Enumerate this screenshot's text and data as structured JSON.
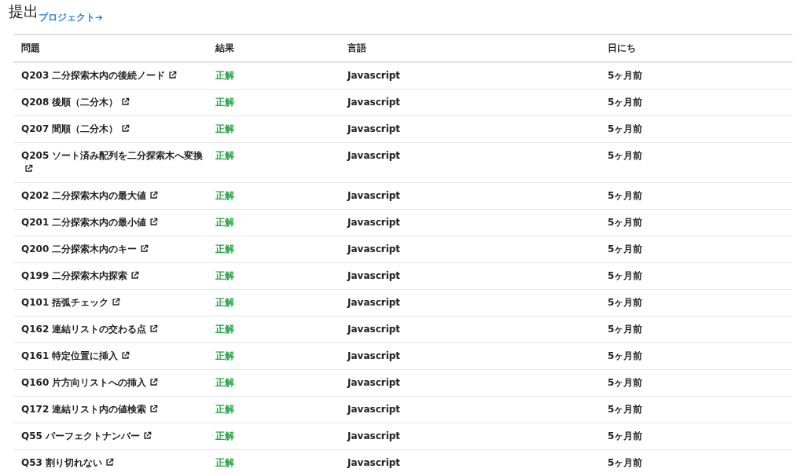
{
  "heading": {
    "title": "提出",
    "link": "プロジェクト➔"
  },
  "table": {
    "columns": [
      "問題",
      "結果",
      "言語",
      "日にち"
    ],
    "rows": [
      {
        "problem": "Q203 二分探索木内の後続ノード",
        "result": "正解",
        "language": "Javascript",
        "date": "5ヶ月前"
      },
      {
        "problem": "Q208 後順（二分木）",
        "result": "正解",
        "language": "Javascript",
        "date": "5ヶ月前"
      },
      {
        "problem": "Q207 間順（二分木）",
        "result": "正解",
        "language": "Javascript",
        "date": "5ヶ月前"
      },
      {
        "problem": "Q205 ソート済み配列を二分探索木へ変換",
        "result": "正解",
        "language": "Javascript",
        "date": "5ヶ月前"
      },
      {
        "problem": "Q202 二分探索木内の最大値",
        "result": "正解",
        "language": "Javascript",
        "date": "5ヶ月前"
      },
      {
        "problem": "Q201 二分探索木内の最小値",
        "result": "正解",
        "language": "Javascript",
        "date": "5ヶ月前"
      },
      {
        "problem": "Q200 二分探索木内のキー",
        "result": "正解",
        "language": "Javascript",
        "date": "5ヶ月前"
      },
      {
        "problem": "Q199 二分探索木内探索",
        "result": "正解",
        "language": "Javascript",
        "date": "5ヶ月前"
      },
      {
        "problem": "Q101 括弧チェック",
        "result": "正解",
        "language": "Javascript",
        "date": "5ヶ月前"
      },
      {
        "problem": "Q162 連結リストの交わる点",
        "result": "正解",
        "language": "Javascript",
        "date": "5ヶ月前"
      },
      {
        "problem": "Q161 特定位置に挿入",
        "result": "正解",
        "language": "Javascript",
        "date": "5ヶ月前"
      },
      {
        "problem": "Q160 片方向リストへの挿入",
        "result": "正解",
        "language": "Javascript",
        "date": "5ヶ月前"
      },
      {
        "problem": "Q172 連結リスト内の値検索",
        "result": "正解",
        "language": "Javascript",
        "date": "5ヶ月前"
      },
      {
        "problem": "Q55 パーフェクトナンバー",
        "result": "正解",
        "language": "Javascript",
        "date": "5ヶ月前"
      },
      {
        "problem": "Q53 割り切れない",
        "result": "正解",
        "language": "Javascript",
        "date": "5ヶ月前"
      }
    ]
  }
}
